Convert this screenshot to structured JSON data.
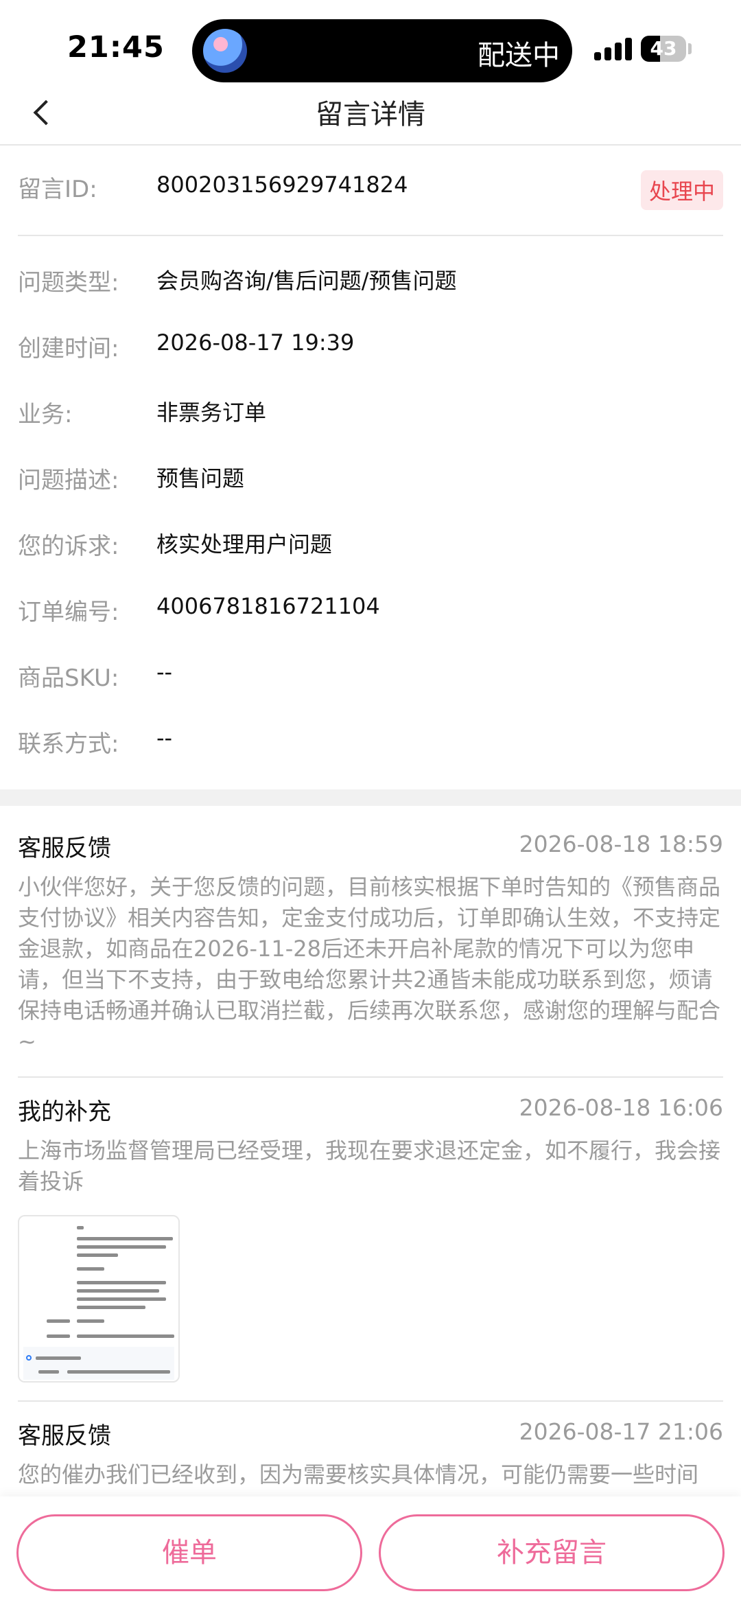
{
  "status_bar": {
    "time": "21:45",
    "live_activity": "配送中",
    "battery": "43",
    "battery_level": 0.43,
    "icons": [
      "avatar-icon",
      "signal-icon",
      "battery-icon"
    ]
  },
  "nav": {
    "title": "留言详情",
    "back_icon": "chevron-left-icon"
  },
  "message": {
    "id_label": "留言ID:",
    "id_value": "800203156929741824",
    "status": "处理中",
    "fields": [
      {
        "label": "问题类型:",
        "value": "会员购咨询/售后问题/预售问题"
      },
      {
        "label": "创建时间:",
        "value": "2026-08-17 19:39"
      },
      {
        "label": "业务:",
        "value": "非票务订单"
      },
      {
        "label": "问题描述:",
        "value": "预售问题"
      },
      {
        "label": "您的诉求:",
        "value": "核实处理用户问题"
      },
      {
        "label": "订单编号:",
        "value": "4006781816721104"
      },
      {
        "label": "商品SKU:",
        "value": "--"
      },
      {
        "label": "联系方式:",
        "value": "--"
      }
    ]
  },
  "feedback": [
    {
      "title": "客服反馈",
      "time": "2026-08-18 18:59",
      "body": "小伙伴您好，关于您反馈的问题，目前核实根据下单时告知的《预售商品支付协议》相关内容告知，定金支付成功后，订单即确认生效，不支持定金退款，如商品在2026-11-28后还未开启补尾款的情况下可以为您申请，但当下不支持，由于致电给您累计共2通皆未能成功联系到您，烦请保持电话畅通并确认已取消拦截，后续再次联系您，感谢您的理解与配合~"
    },
    {
      "title": "我的补充",
      "time": "2026-08-18 16:06",
      "body": "上海市场监督管理局已经受理，我现在要求退还定金，如不履行，我会接着投诉",
      "attachment": "document-thumbnail"
    },
    {
      "title": "客服反馈",
      "time": "2026-08-17 21:06",
      "body": "您的催办我们已经收到，因为需要核实具体情况，可能仍需要一些时间"
    }
  ],
  "actions": {
    "urge_label": "催单",
    "supplement_label": "补充留言"
  },
  "colors": {
    "accent": "#ee6b9a",
    "status_text": "#e8464f",
    "status_bg": "#fde8ea",
    "label_gray": "#9b9b9b"
  }
}
